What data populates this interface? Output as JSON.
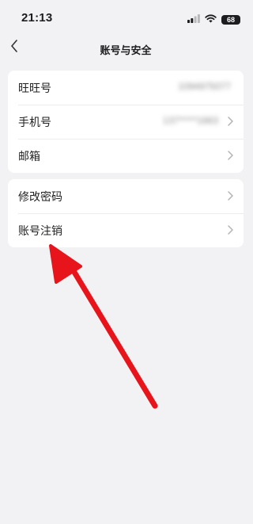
{
  "status_bar": {
    "time": "21:13",
    "battery_level": "68",
    "icons": [
      "signal-icon",
      "wifi-icon",
      "battery-icon"
    ]
  },
  "nav": {
    "title": "账号与安全",
    "back_icon": "chevron-left-icon"
  },
  "sections": [
    {
      "rows": [
        {
          "label": "旺旺号",
          "value": "1094975077",
          "chevron": false
        },
        {
          "label": "手机号",
          "value": "137*****1663",
          "chevron": true
        },
        {
          "label": "邮箱",
          "value": "",
          "chevron": true
        }
      ]
    },
    {
      "rows": [
        {
          "label": "修改密码",
          "value": "",
          "chevron": true
        },
        {
          "label": "账号注销",
          "value": "",
          "chevron": true
        }
      ]
    }
  ],
  "annotation": {
    "type": "arrow",
    "color": "#e8141b",
    "points_to": "账号注销"
  }
}
